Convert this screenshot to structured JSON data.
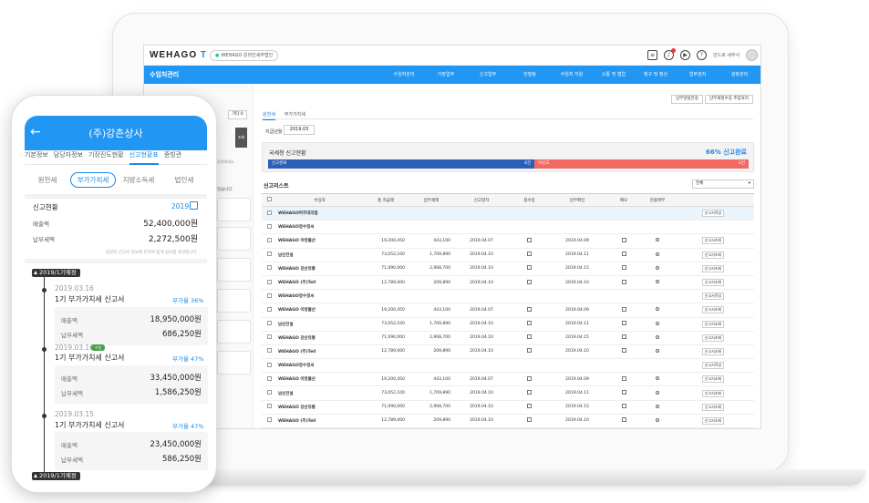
{
  "desktop": {
    "logo_text": "WEHAGO",
    "logo_suffix": "T",
    "company_chip": "WEHAGO 온라인세무법인",
    "username": "안드로 세무사",
    "header_title": "수임처관리",
    "menu": [
      "수임처관리",
      "기장업무",
      "신고업무",
      "전빌링",
      "수임처 지원",
      "소통 및 협업",
      "청구 및 정산",
      "업무관리",
      "설정관리"
    ],
    "top_buttons": [
      "납부알림전송",
      "납부세정수증 추입처리"
    ],
    "left_tab_other": "기타 0",
    "left_search": "조회",
    "left_placeholder": "검색해세요",
    "left_hint": "었습니다.",
    "tabs": [
      "원천세",
      "부가가치세"
    ],
    "field_label": "지급년월",
    "field_value": "2019.03",
    "status": {
      "title": "국세청 신고현황",
      "pct": "66% 신고완료",
      "done_label": "신고완료",
      "done_count": "4건",
      "not_label": "미신고",
      "not_count": "2건"
    },
    "list_title": "신고리스트",
    "list_filter": "전체",
    "columns": [
      "",
      "수임처",
      "총 지급액",
      "납부세액",
      "신고일자",
      "접수증",
      "납부확인",
      "메모",
      "전송여부",
      ""
    ],
    "rows": [
      {
        "name": "WEHAGO여주대리점",
        "total": "",
        "tax": "",
        "date": "",
        "paydate": "",
        "btn": "신고서작성",
        "hl": true,
        "icons": false
      },
      {
        "name": "WEHAGO정수정씨",
        "total": "",
        "tax": "",
        "date": "",
        "paydate": "",
        "btn": "",
        "hl": false,
        "icons": false
      },
      {
        "name": "WEHAGO 이방물산",
        "total": "19,200,450",
        "tax": "443,100",
        "date": "2019.04.07",
        "paydate": "2019.04.09",
        "btn": "신고서조회",
        "hl": false,
        "icons": true
      },
      {
        "name": "남산건설",
        "total": "73,052,100",
        "tax": "1,709,890",
        "date": "2019.04.10",
        "paydate": "2019.04.11",
        "btn": "신고서조회",
        "hl": false,
        "icons": true
      },
      {
        "name": "WEHAGO 강산유통",
        "total": "71,090,000",
        "tax": "2,908,700",
        "date": "2019.04.10",
        "paydate": "2019.04.15",
        "btn": "신고서조회",
        "hl": false,
        "icons": true
      },
      {
        "name": "WEHAGO (주)Tell",
        "total": "12,789,000",
        "tax": "209,890",
        "date": "2019.04.10",
        "paydate": "2019.04.10",
        "btn": "신고서조회",
        "hl": false,
        "icons": true
      },
      {
        "name": "WEHAGO정수정씨",
        "total": "",
        "tax": "",
        "date": "",
        "paydate": "",
        "btn": "신고서작성",
        "hl": false,
        "icons": false
      },
      {
        "name": "WEHAGO 이방물산",
        "total": "19,200,450",
        "tax": "443,100",
        "date": "2019.04.07",
        "paydate": "2019.04.09",
        "btn": "신고서조회",
        "hl": false,
        "icons": true
      },
      {
        "name": "남산건설",
        "total": "73,052,100",
        "tax": "1,709,890",
        "date": "2019.04.10",
        "paydate": "2019.04.11",
        "btn": "신고서조회",
        "hl": false,
        "icons": true
      },
      {
        "name": "WEHAGO 강산유통",
        "total": "71,090,000",
        "tax": "2,908,700",
        "date": "2019.04.10",
        "paydate": "2019.04.15",
        "btn": "신고서조회",
        "hl": false,
        "icons": true
      },
      {
        "name": "WEHAGO (주)Tell",
        "total": "12,789,000",
        "tax": "209,890",
        "date": "2019.04.10",
        "paydate": "2019.04.10",
        "btn": "신고서조회",
        "hl": false,
        "icons": true
      },
      {
        "name": "WEHAGO정수정씨",
        "total": "",
        "tax": "",
        "date": "",
        "paydate": "",
        "btn": "신고서작성",
        "hl": false,
        "icons": false
      },
      {
        "name": "WEHAGO 이방물산",
        "total": "19,200,450",
        "tax": "443,100",
        "date": "2019.04.07",
        "paydate": "2019.04.09",
        "btn": "신고서조회",
        "hl": false,
        "icons": true
      },
      {
        "name": "남산건설",
        "total": "73,052,100",
        "tax": "1,709,890",
        "date": "2019.04.10",
        "paydate": "2019.04.11",
        "btn": "신고서조회",
        "hl": false,
        "icons": true
      },
      {
        "name": "WEHAGO 강산유통",
        "total": "71,090,000",
        "tax": "2,908,700",
        "date": "2019.04.10",
        "paydate": "2019.04.15",
        "btn": "신고서조회",
        "hl": false,
        "icons": true
      },
      {
        "name": "WEHAGO (주)Tell",
        "total": "12,789,000",
        "tax": "209,890",
        "date": "2019.04.10",
        "paydate": "2019.04.10",
        "btn": "신고서조회",
        "hl": false,
        "icons": true
      }
    ]
  },
  "phone": {
    "title": "(주)강촌상사",
    "tabs": [
      "기본정보",
      "담당자정보",
      "기장진도현황",
      "신고현황표",
      "증빙관"
    ],
    "seg": [
      "원천세",
      "부가가치세",
      "지방소득세",
      "법인세"
    ],
    "report_title": "신고현황",
    "report_year": "2019",
    "sales_label": "매출액",
    "sales_value": "52,400,000원",
    "tax_label": "납부세액",
    "tax_value": "2,272,500원",
    "note": "광징된 신고서 정보에 한하여 합계 정보를 표현합니다.",
    "badge_top": "2019/1기예정",
    "badge_bottom": "2019/1기예정",
    "cards": [
      {
        "date": "2019.03.16",
        "chip": "",
        "title": "1기 부가가치세 신고서",
        "rate": "부가율 36%",
        "sales": "18,950,000원",
        "tax": "686,250원"
      },
      {
        "date": "2019.03.16",
        "chip": "수정",
        "title": "1기 부가가치세 신고서",
        "rate": "부가율 47%",
        "sales": "33,450,000원",
        "tax": "1,586,250원"
      },
      {
        "date": "2019.03.15",
        "chip": "",
        "title": "1기 부가가치세 신고서",
        "rate": "부가율 47%",
        "sales": "23,450,000원",
        "tax": "586,250원"
      }
    ],
    "card_sales_label": "매출액",
    "card_tax_label": "납부세액"
  }
}
